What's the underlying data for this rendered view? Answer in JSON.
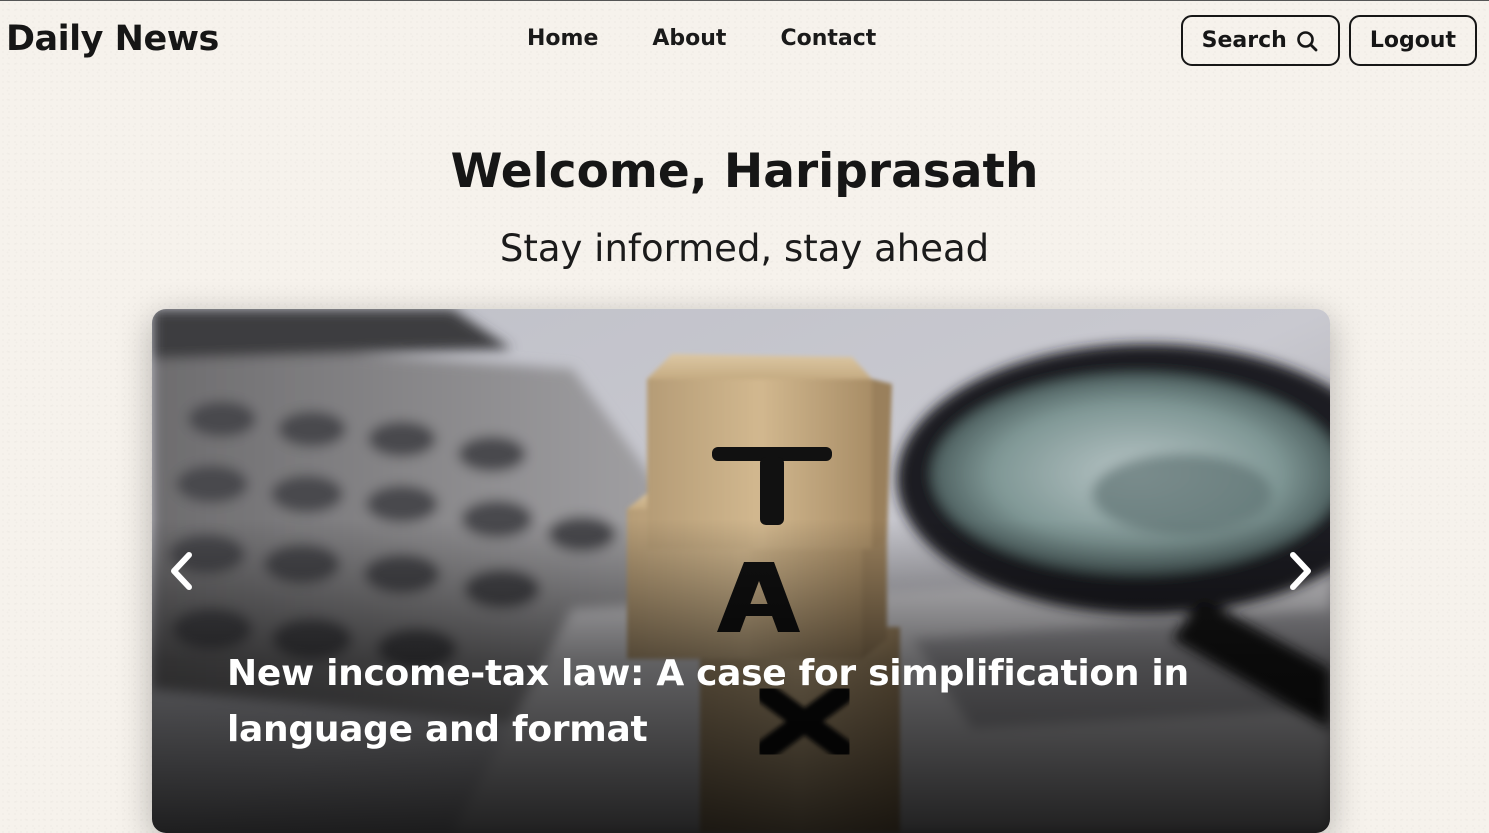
{
  "brand": {
    "title": "Daily News"
  },
  "nav": {
    "links": [
      {
        "label": "Home"
      },
      {
        "label": "About"
      },
      {
        "label": "Contact"
      }
    ],
    "search_label": "Search",
    "logout_label": "Logout"
  },
  "hero": {
    "welcome": "Welcome, Hariprasath",
    "tagline": "Stay informed, stay ahead"
  },
  "carousel": {
    "slide_caption": "New income-tax law: A case for simplification in language and format",
    "slide_image_letters": [
      "T",
      "A",
      "X"
    ],
    "prev_icon": "chevron-left-icon",
    "next_icon": "chevron-right-icon"
  },
  "colors": {
    "background": "#f6f2ec",
    "text": "#161616",
    "caption": "#ffffff"
  },
  "icons": {
    "search": "search-icon"
  }
}
